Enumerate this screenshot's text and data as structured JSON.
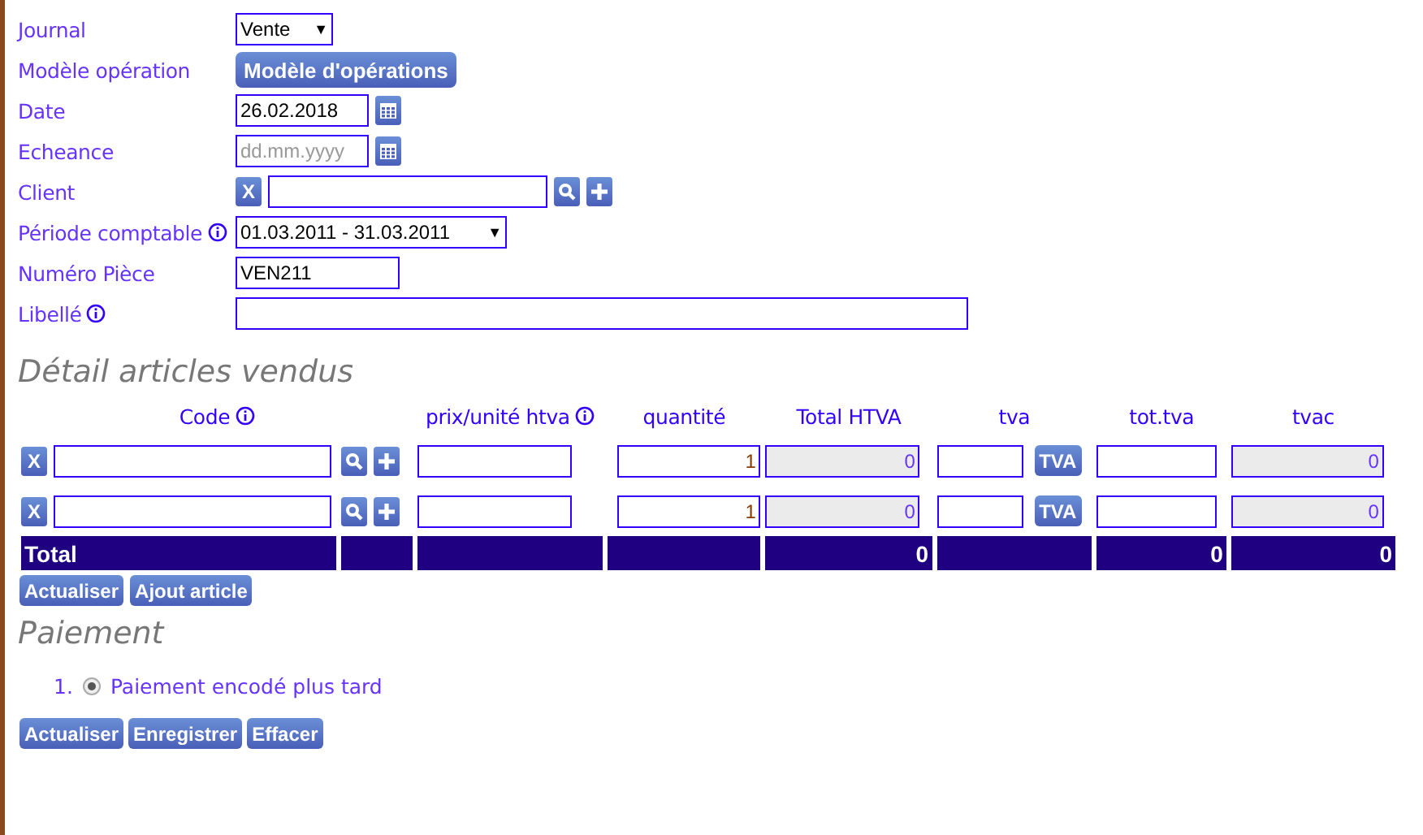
{
  "form": [
    {
      "kind": "select",
      "label": "Journal",
      "value": "Vente",
      "arrow": "▼"
    },
    {
      "kind": "button",
      "label": "Modèle opération",
      "button": "Modèle d'opérations"
    },
    {
      "kind": "date",
      "label": "Date",
      "value": "26.02.2018"
    },
    {
      "kind": "date",
      "label": "Echeance",
      "placeholder": "dd.mm.yyyy"
    },
    {
      "kind": "lookup",
      "label": "Client",
      "clear": "X"
    },
    {
      "kind": "select",
      "label": "Période comptable",
      "info": true,
      "value": "01.03.2011 - 31.03.2011",
      "arrow": "▼"
    },
    {
      "kind": "text",
      "label": "Numéro Pièce",
      "value": "VEN211"
    },
    {
      "kind": "wide",
      "label": "Libellé",
      "info": true
    }
  ],
  "detail": {
    "title": "Détail articles vendus",
    "columns": [
      {
        "label": "Code",
        "info": true
      },
      {
        "label": "prix/unité htva",
        "info": true
      },
      {
        "label": "quantité"
      },
      {
        "label": "Total HTVA"
      },
      {
        "label": "tva"
      },
      {
        "label": "tot.tva"
      },
      {
        "label": "tvac"
      }
    ],
    "rows": [
      {
        "clear": "X",
        "quantity": "1",
        "total_htva": "0",
        "tva_button": "TVA",
        "tvac": "0"
      },
      {
        "clear": "X",
        "quantity": "1",
        "total_htva": "0",
        "tva_button": "TVA",
        "tvac": "0"
      }
    ],
    "total": {
      "label": "Total",
      "total_htva": "0",
      "tot_tva": "0",
      "tvac": "0"
    },
    "buttons": [
      "Actualiser",
      "Ajout article"
    ]
  },
  "payment": {
    "title": "Paiement",
    "options": [
      {
        "number": "1.",
        "label": "Paiement encodé plus tard",
        "selected": true
      }
    ]
  },
  "buttons": [
    "Actualiser",
    "Enregistrer",
    "Effacer"
  ]
}
